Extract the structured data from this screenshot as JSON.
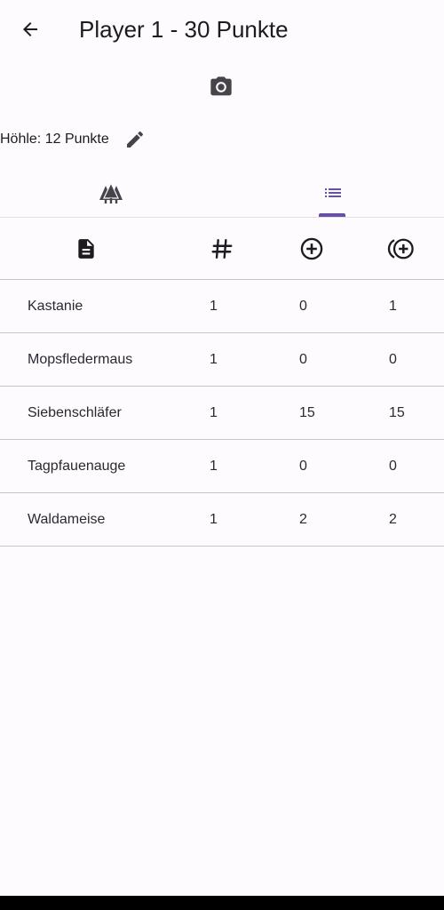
{
  "header": {
    "title": "Player 1 - 30 Punkte",
    "back_icon": "arrow-back-icon"
  },
  "camera": {
    "icon": "camera-icon"
  },
  "score": {
    "label": "Höhle: 12 Punkte",
    "edit_icon": "edit-pencil-icon"
  },
  "tabs": [
    {
      "icon": "trees-icon",
      "selected": false
    },
    {
      "icon": "list-icon",
      "selected": true
    }
  ],
  "colors": {
    "accent": "#6750a4",
    "background": "#fefbff",
    "divider": "#cac4d0",
    "text": "#1c1b1f"
  },
  "table": {
    "column_icons": [
      "document-icon",
      "hash-icon",
      "plus-circle-icon",
      "plus-circle-multiple-icon"
    ],
    "rows": [
      {
        "name": "Kastanie",
        "count": "1",
        "plus": "0",
        "total": "1"
      },
      {
        "name": "Mopsfledermaus",
        "count": "1",
        "plus": "0",
        "total": "0"
      },
      {
        "name": "Siebenschläfer",
        "count": "1",
        "plus": "15",
        "total": "15"
      },
      {
        "name": "Tagpfauenauge",
        "count": "1",
        "plus": "0",
        "total": "0"
      },
      {
        "name": "Waldameise",
        "count": "1",
        "plus": "2",
        "total": "2"
      }
    ]
  }
}
